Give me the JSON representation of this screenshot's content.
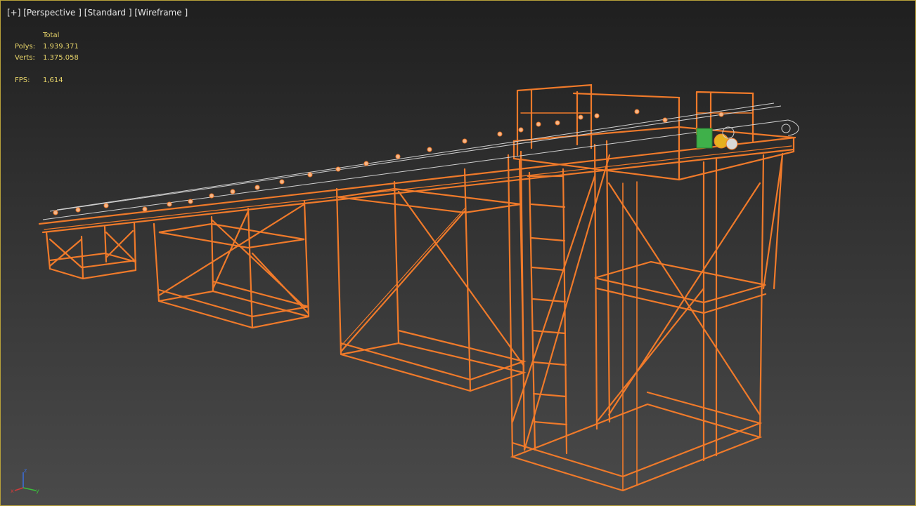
{
  "viewport_labels": {
    "plus": "[+]",
    "view": "[Perspective ]",
    "shading": "[Standard ]",
    "display": "[Wireframe ]"
  },
  "stats": {
    "header": "Total",
    "polys_label": "Polys:",
    "polys_value": "1.939.371",
    "verts_label": "Verts:",
    "verts_value": "1.375.058",
    "fps_label": "FPS:",
    "fps_value": "1,614"
  },
  "axis_tripod": {
    "z": "z",
    "x": "x",
    "y": "y"
  },
  "colors": {
    "wire": "#f07a2a",
    "belt": "#d0d0d0",
    "stats_text": "#e8d56a",
    "motor_green": "#3fb04a",
    "motor_yellow": "#e6b020",
    "border": "#b9a23a"
  }
}
